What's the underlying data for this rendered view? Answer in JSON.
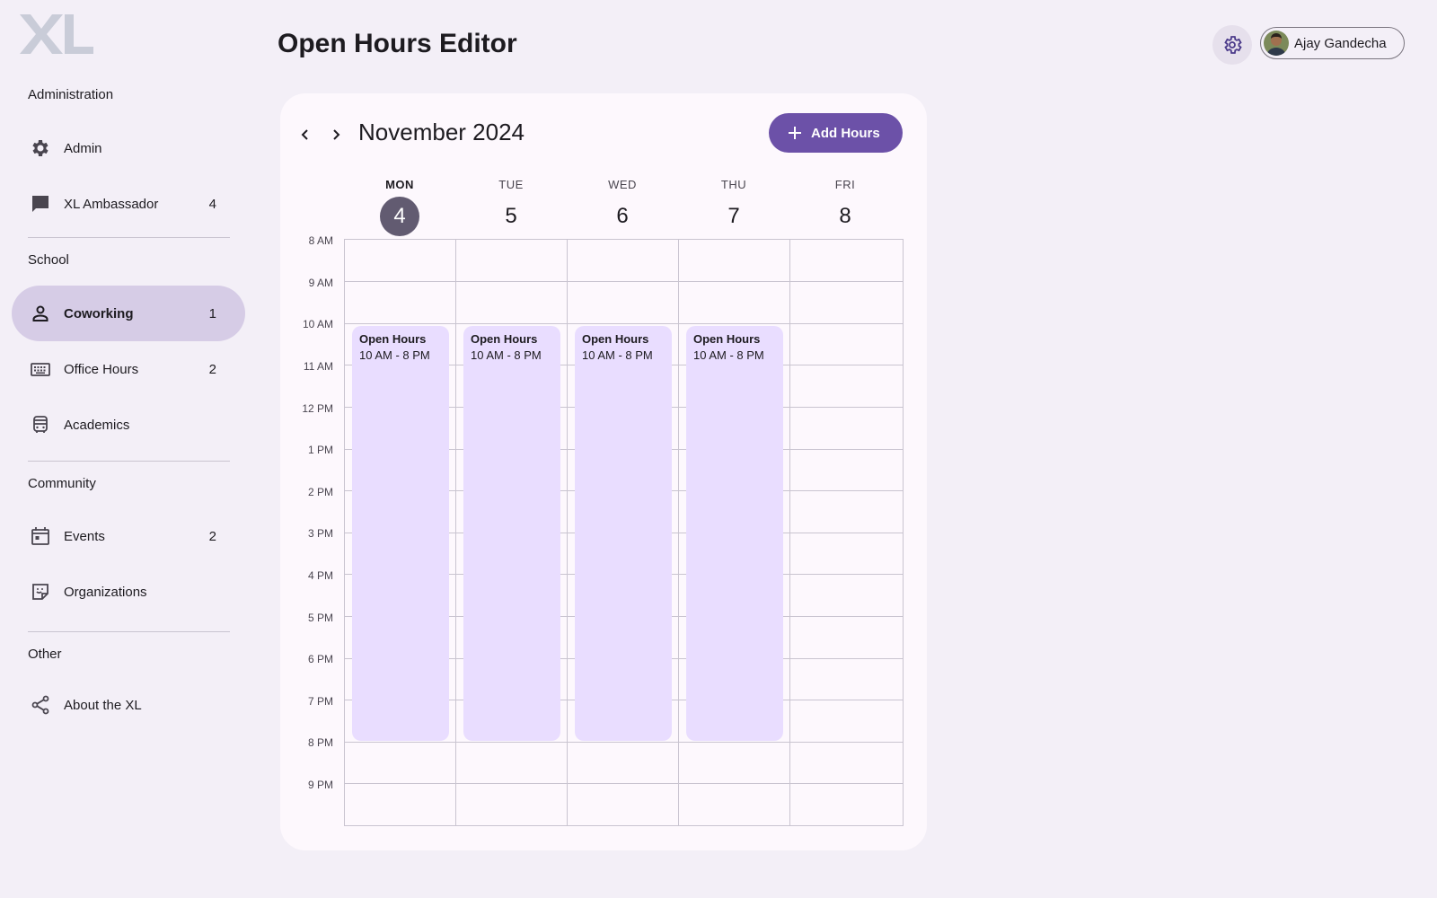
{
  "app": {
    "logo_text": "XL"
  },
  "header": {
    "title": "Open Hours Editor",
    "user_name": "Ajay Gandecha"
  },
  "sidebar": {
    "sections": [
      {
        "label": "Administration",
        "items": [
          {
            "label": "Admin",
            "badge": "",
            "icon": "gear-icon"
          },
          {
            "label": "XL Ambassador",
            "badge": "4",
            "icon": "chat-icon"
          }
        ]
      },
      {
        "label": "School",
        "items": [
          {
            "label": "Coworking",
            "badge": "1",
            "icon": "person-icon",
            "active": true
          },
          {
            "label": "Office Hours",
            "badge": "2",
            "icon": "keyboard-icon"
          },
          {
            "label": "Academics",
            "badge": "",
            "icon": "bus-icon"
          }
        ]
      },
      {
        "label": "Community",
        "items": [
          {
            "label": "Events",
            "badge": "2",
            "icon": "calendar-icon"
          },
          {
            "label": "Organizations",
            "badge": "",
            "icon": "sticky-note-icon"
          }
        ]
      },
      {
        "label": "Other",
        "items": [
          {
            "label": "About the XL",
            "badge": "",
            "icon": "share-icon"
          }
        ]
      }
    ]
  },
  "calendar": {
    "month_title": "November 2024",
    "add_button": "Add Hours",
    "days": [
      {
        "dow": "MON",
        "num": "4",
        "today": true
      },
      {
        "dow": "TUE",
        "num": "5"
      },
      {
        "dow": "WED",
        "num": "6"
      },
      {
        "dow": "THU",
        "num": "7"
      },
      {
        "dow": "FRI",
        "num": "8"
      }
    ],
    "hours": [
      "8 AM",
      "9 AM",
      "10 AM",
      "11 AM",
      "12 PM",
      "1 PM",
      "2 PM",
      "3 PM",
      "4 PM",
      "5 PM",
      "6 PM",
      "7 PM",
      "8 PM",
      "9 PM"
    ],
    "events": [
      {
        "day": "MON",
        "title": "Open Hours",
        "time": "10 AM - 8 PM"
      },
      {
        "day": "TUE",
        "title": "Open Hours",
        "time": "10 AM - 8 PM"
      },
      {
        "day": "WED",
        "title": "Open Hours",
        "time": "10 AM - 8 PM"
      },
      {
        "day": "THU",
        "title": "Open Hours",
        "time": "10 AM - 8 PM"
      }
    ]
  },
  "colors": {
    "accent": "#6c51a8",
    "event_bg": "#e9ddff",
    "active_nav": "#d6cce6",
    "today": "#625b71"
  }
}
